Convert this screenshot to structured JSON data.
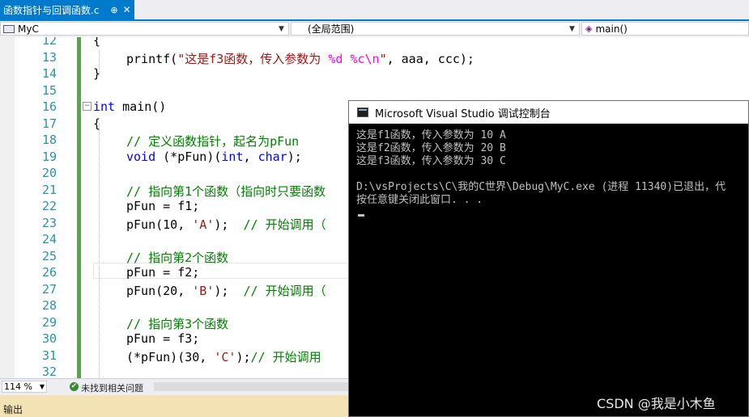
{
  "tab": {
    "title": "函数指针与回调函数.c",
    "pin_glyph": "⊕",
    "close_glyph": "✕"
  },
  "nav": {
    "project": "MyC",
    "scope": "(全局范围)",
    "member": "main()"
  },
  "editor": {
    "lines": [
      {
        "num": "12",
        "code": "{"
      },
      {
        "num": "13",
        "code": "printf(\"这是f3函数，传入参数为 %d %c\\n\", aaa, ccc);"
      },
      {
        "num": "14",
        "code": "}"
      },
      {
        "num": "15",
        "code": ""
      },
      {
        "num": "16",
        "code": "int main()"
      },
      {
        "num": "17",
        "code": "{"
      },
      {
        "num": "18",
        "code": "// 定义函数指针，起名为pFun"
      },
      {
        "num": "19",
        "code": "void (*pFun)(int, char);"
      },
      {
        "num": "20",
        "code": ""
      },
      {
        "num": "21",
        "code": "// 指向第1个函数（指向时只要函数"
      },
      {
        "num": "22",
        "code": "pFun = f1;"
      },
      {
        "num": "23",
        "code": "pFun(10, 'A');  // 开始调用（"
      },
      {
        "num": "24",
        "code": ""
      },
      {
        "num": "25",
        "code": "// 指向第2个函数"
      },
      {
        "num": "26",
        "code": "pFun = f2;"
      },
      {
        "num": "27",
        "code": "pFun(20, 'B');  // 开始调用（"
      },
      {
        "num": "28",
        "code": ""
      },
      {
        "num": "29",
        "code": "// 指向第3个函数"
      },
      {
        "num": "30",
        "code": "pFun = f3;"
      },
      {
        "num": "31",
        "code": "(*pFun)(30, 'C');// 开始调用"
      },
      {
        "num": "32",
        "code": ""
      }
    ]
  },
  "status": {
    "zoom": "114 %",
    "issues": "未找到相关问题"
  },
  "output_panel": {
    "label": "输出"
  },
  "console": {
    "title": "Microsoft Visual Studio 调试控制台",
    "lines": [
      "这是f1函数，传入参数为 10 A",
      "这是f2函数，传入参数为 20 B",
      "这是f3函数，传入参数为 30 C",
      "",
      "D:\\vsProjects\\C\\我的C世界\\Debug\\MyC.exe (进程 11340)已退出，代",
      "按任意键关闭此窗口. . ."
    ]
  },
  "watermark": "CSDN @我是小木鱼",
  "colors": {
    "accent": "#007acc",
    "keyword": "#0000ff",
    "string": "#a31515",
    "comment": "#008000",
    "line_number": "#2b91af",
    "console_bg": "#000000"
  }
}
